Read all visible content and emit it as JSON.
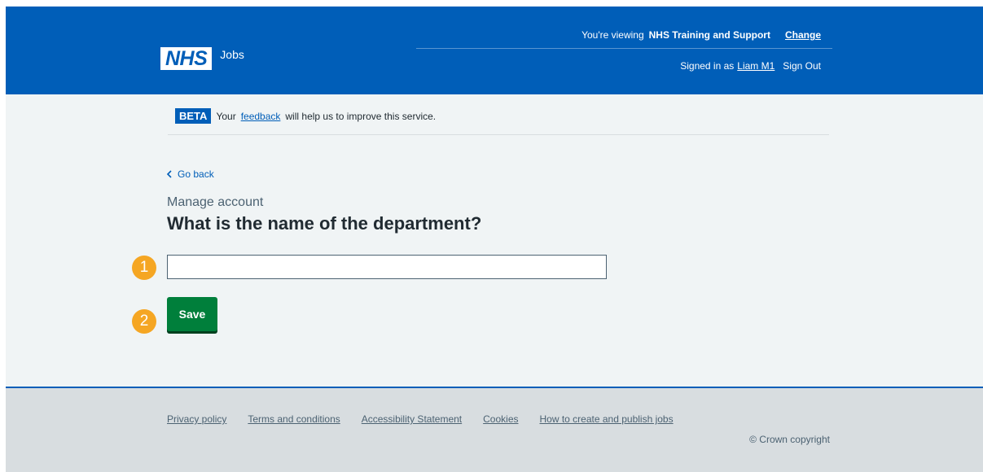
{
  "header": {
    "viewing_prefix": "You're viewing",
    "organisation": "NHS Training and Support",
    "change_label": "Change",
    "logo_text": "NHS",
    "service_name": "Jobs",
    "signed_in_prefix": "Signed in as",
    "user_name": "Liam M1",
    "sign_out_label": "Sign Out"
  },
  "phase_banner": {
    "tag": "BETA",
    "text_before": "Your",
    "link_text": "feedback",
    "text_after": "will help us to improve this service."
  },
  "main": {
    "back_label": "Go back",
    "caption": "Manage account",
    "heading": "What is the name of the department?",
    "input_value": "",
    "save_label": "Save"
  },
  "annotations": {
    "badge_1": "1",
    "badge_2": "2",
    "badge_color": "#f5a623"
  },
  "footer": {
    "links": [
      "Privacy policy",
      "Terms and conditions",
      "Accessibility Statement",
      "Cookies",
      "How to create and publish jobs"
    ],
    "copyright": "© Crown copyright"
  },
  "colors": {
    "nhs_blue": "#005eb8",
    "save_green": "#007f3b",
    "background": "#f0f4f5",
    "footer_bg": "#d8dde0"
  }
}
